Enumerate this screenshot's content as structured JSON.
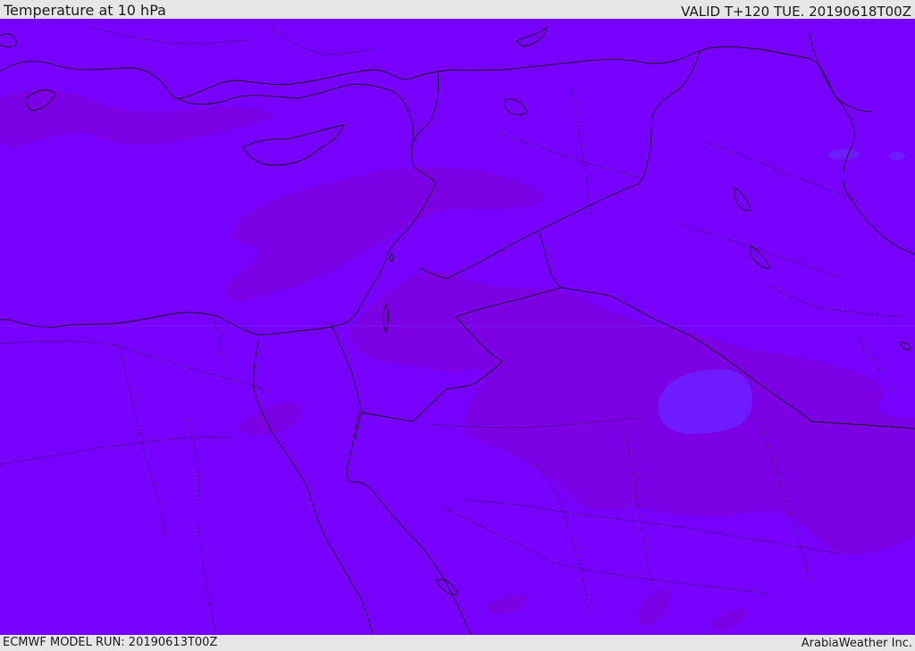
{
  "header": {
    "title": "Temperature at 10 hPa",
    "valid": "VALID T+120 TUE. 20190618T00Z"
  },
  "footer": {
    "model_run": "ECMWF MODEL RUN: 20190613T00Z",
    "credit": "ArabiaWeather Inc."
  },
  "map": {
    "field_colors": {
      "base": "#7800ff",
      "darker": "#7b00e4",
      "lighter": "#6e1bff"
    },
    "boundary_color": "#1a1a1a"
  }
}
